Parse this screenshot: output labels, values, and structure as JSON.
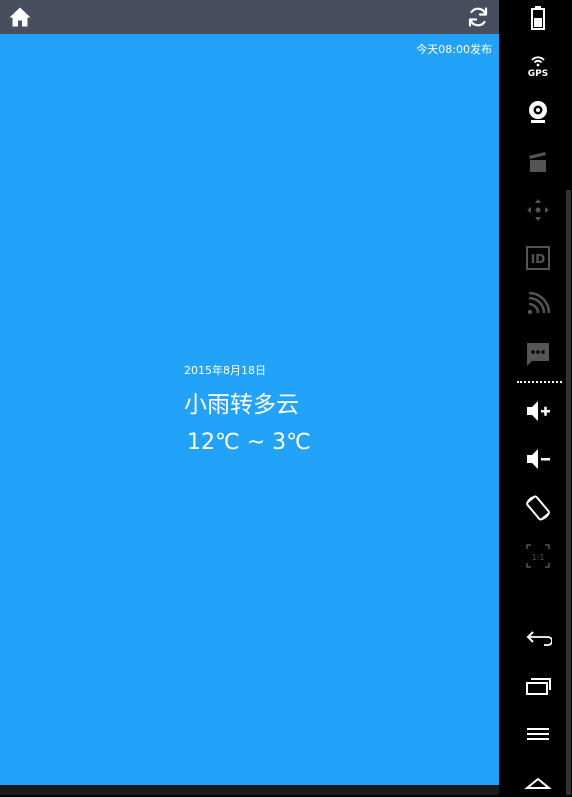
{
  "header": {
    "home_icon": "home-icon",
    "refresh_icon": "refresh-icon"
  },
  "publish_time": "今天08:00发布",
  "weather": {
    "date": "2015年8月18日",
    "description": "小雨转多云",
    "temperature": "12℃ ~ 3℃"
  },
  "colors": {
    "background": "#22A2F8",
    "titlebar": "#484E5E",
    "text": "#FFFFFF"
  },
  "sidebar": {
    "icons": [
      "battery-icon",
      "gps-icon",
      "webcam-icon",
      "clapperboard-icon",
      "dpad-icon",
      "id-icon",
      "cast-icon",
      "sms-icon",
      "volume-up-icon",
      "volume-down-icon",
      "rotate-icon",
      "scale-icon",
      "back-icon",
      "recent-apps-icon",
      "menu-icon",
      "home-nav-icon"
    ],
    "gps_label": "GPS",
    "id_label": "ID",
    "scale_label": "1:1"
  }
}
